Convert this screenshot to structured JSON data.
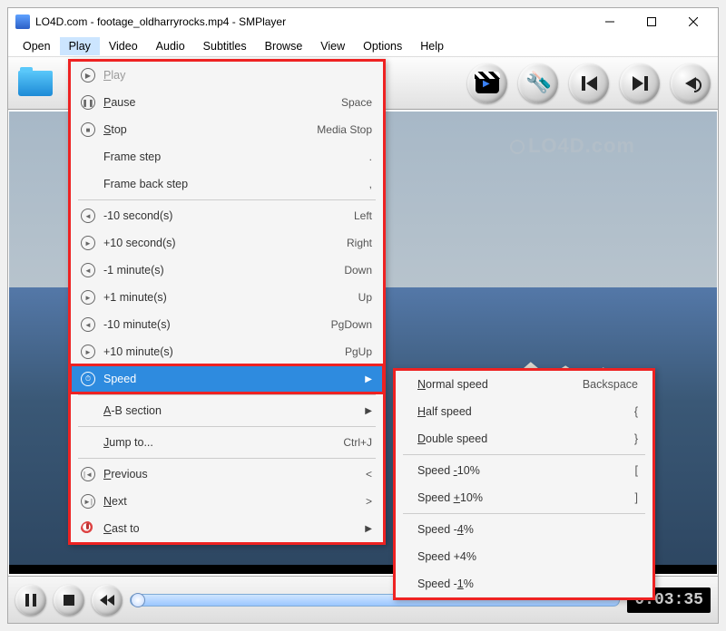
{
  "title": "LO4D.com - footage_oldharryrocks.mp4 - SMPlayer",
  "watermark": "LO4D.com",
  "menubar": [
    "Open",
    "Play",
    "Video",
    "Audio",
    "Subtitles",
    "Browse",
    "View",
    "Options",
    "Help"
  ],
  "active_menu_index": 1,
  "time_display": "0:03:35",
  "play_menu": {
    "items": [
      {
        "icon": "play",
        "label": "Play",
        "shortcut": "",
        "disabled": true,
        "u": 0
      },
      {
        "icon": "pause",
        "label": "Pause",
        "shortcut": "Space",
        "u": 0
      },
      {
        "icon": "stop",
        "label": "Stop",
        "shortcut": "Media Stop",
        "u": 0
      },
      {
        "icon": "",
        "label": "Frame step",
        "shortcut": ".",
        "u": -1
      },
      {
        "icon": "",
        "label": "Frame back step",
        "shortcut": ",",
        "u": -1
      }
    ],
    "seek": [
      {
        "icon": "back",
        "label": "-10 second(s)",
        "shortcut": "Left"
      },
      {
        "icon": "fwd",
        "label": "+10 second(s)",
        "shortcut": "Right"
      },
      {
        "icon": "back",
        "label": "-1 minute(s)",
        "shortcut": "Down"
      },
      {
        "icon": "fwd",
        "label": "+1 minute(s)",
        "shortcut": "Up"
      },
      {
        "icon": "back",
        "label": "-10 minute(s)",
        "shortcut": "PgDown"
      },
      {
        "icon": "fwd",
        "label": "+10 minute(s)",
        "shortcut": "PgUp"
      }
    ],
    "speed": {
      "icon": "speed",
      "label": "Speed",
      "highlight": true,
      "submenu": true
    },
    "after": [
      {
        "icon": "",
        "label": "A-B section",
        "submenu": true,
        "u": 0
      },
      {
        "icon": "",
        "label": "Jump to...",
        "shortcut": "Ctrl+J",
        "u": 0
      },
      {
        "icon": "prev",
        "label": "Previous",
        "shortcut": "<",
        "u": 0
      },
      {
        "icon": "next",
        "label": "Next",
        "shortcut": ">",
        "u": 0
      },
      {
        "icon": "cast",
        "label": "Cast to",
        "submenu": true,
        "u": 0
      }
    ]
  },
  "speed_submenu": {
    "group1": [
      {
        "label": "Normal speed",
        "shortcut": "Backspace",
        "u": 0
      },
      {
        "label": "Half speed",
        "shortcut": "{",
        "u": 0
      },
      {
        "label": "Double speed",
        "shortcut": "}",
        "u": 0
      }
    ],
    "group2": [
      {
        "label": "Speed -10%",
        "shortcut": "[",
        "u": 6
      },
      {
        "label": "Speed +10%",
        "shortcut": "]",
        "u": 6
      }
    ],
    "group3": [
      {
        "label": "Speed -4%",
        "shortcut": "",
        "u": 7
      },
      {
        "label": "Speed +4%",
        "shortcut": "",
        "u": -1
      },
      {
        "label": "Speed -1%",
        "shortcut": "",
        "u": 7
      }
    ]
  }
}
